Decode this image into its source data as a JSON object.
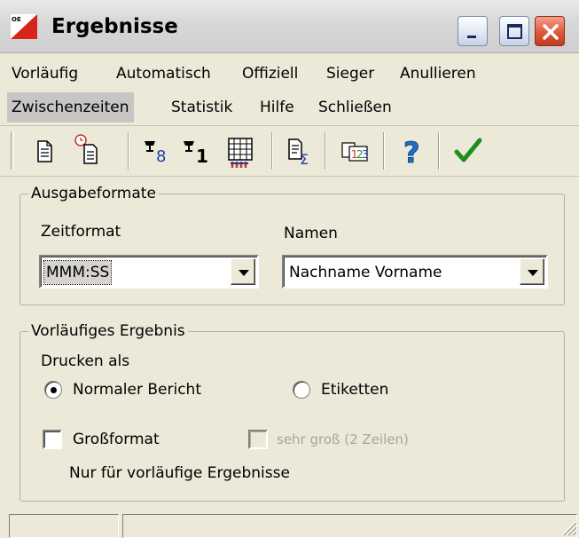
{
  "window": {
    "title": "Ergebnisse",
    "icon_text": "OE",
    "controls": [
      "minimize",
      "maximize",
      "close"
    ]
  },
  "menu": {
    "row1": [
      "Vorläufig",
      "Automatisch",
      "Offiziell",
      "Sieger",
      "Anullieren"
    ],
    "row2": [
      "Zwischenzeiten",
      "Statistik",
      "Hilfe",
      "Schließen"
    ],
    "active_item": "Zwischenzeiten"
  },
  "toolbar": {
    "buttons": [
      "document-icon",
      "clock-document-icon",
      "trophy-8-icon",
      "trophy-1-icon",
      "grid-people-icon",
      "document-sum-icon",
      "numbers-123-icon",
      "help-icon",
      "checkmark-icon"
    ]
  },
  "ausgabeformate": {
    "legend": "Ausgabeformate",
    "zeitformat_label": "Zeitformat",
    "zeitformat_value": "MMM:SS",
    "namen_label": "Namen",
    "namen_value": "Nachname Vorname"
  },
  "vorlaeufig": {
    "legend": "Vorläufiges Ergebnis",
    "drucken_als": "Drucken als",
    "radio_normal": "Normaler Bericht",
    "radio_etiketten": "Etiketten",
    "selected_radio": "Normaler Bericht",
    "check_grossformat": "Großformat",
    "check_sehr_gross": "sehr groß (2 Zeilen)",
    "note": "Nur für vorläufige Ergebnisse"
  },
  "colors": {
    "face": "#ece9d8",
    "check_green": "#1e8f1e",
    "help_blue": "#1c6fc7",
    "close_red": "#e0583b"
  }
}
